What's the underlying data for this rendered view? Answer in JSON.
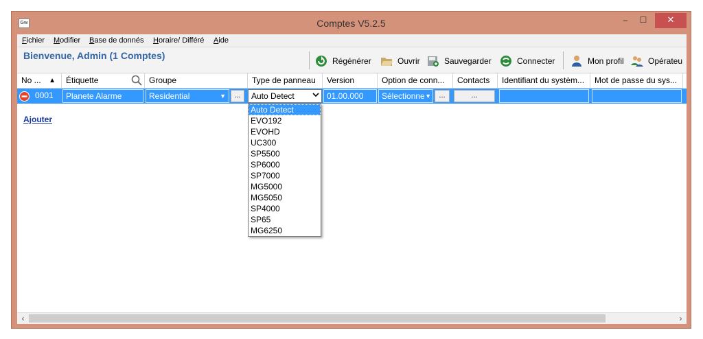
{
  "window": {
    "title": "Comptes V5.2.5",
    "app_icon_label": "Gw",
    "minimize_symbol": "–",
    "maximize_symbol": "☐",
    "close_symbol": "✕"
  },
  "menu": [
    {
      "accel": "F",
      "rest": "ichier"
    },
    {
      "accel": "M",
      "rest": "odifier"
    },
    {
      "accel": "B",
      "rest": "ase de donnés"
    },
    {
      "accel": "H",
      "rest": "oraire/ Différé"
    },
    {
      "accel": "A",
      "rest": "ide"
    }
  ],
  "toolbar": {
    "welcome": "Bienvenue, Admin  (1 Comptes)",
    "buttons": [
      {
        "label": "Régénérer",
        "icon": "refresh-icon"
      },
      {
        "label": "Ouvrir",
        "icon": "folder-open-icon"
      },
      {
        "label": "Sauvegarder",
        "icon": "save-icon"
      },
      {
        "label": "Connecter",
        "icon": "connect-icon"
      },
      {
        "label": "Mon profil",
        "icon": "user-icon"
      },
      {
        "label": "Opérateu",
        "icon": "operators-icon"
      }
    ]
  },
  "grid": {
    "columns": [
      "No ...",
      "Étiquette",
      "Groupe",
      "Type de panneau",
      "Version",
      "Option de conn...",
      "Contacts",
      "Identifiant du systèm...",
      "Mot de passe du sys..."
    ],
    "sort_indicator": "▲",
    "row": {
      "number": "0001",
      "label": "Planete Alarme",
      "group": "Residential",
      "panel_type": "Auto Detect",
      "version": "01.00.000",
      "connection_option": "Sélectionner",
      "ellipsis": "...",
      "contacts": "...",
      "system_id": "",
      "system_password": ""
    },
    "panel_options": [
      "Auto Detect",
      "EVO192",
      "EVOHD",
      "UC300",
      "SP5500",
      "SP6000",
      "SP7000",
      "MG5000",
      "MG5050",
      "SP4000",
      "SP65",
      "MG6250"
    ],
    "selected_option": "Auto Detect"
  },
  "add_link": "Ajouter",
  "scrollbar": {
    "left_arrow": "‹",
    "right_arrow": "›"
  },
  "colors": {
    "selection": "#3399ff",
    "title_bar": "#d5927b",
    "welcome": "#3465a4",
    "close": "#c75050"
  }
}
